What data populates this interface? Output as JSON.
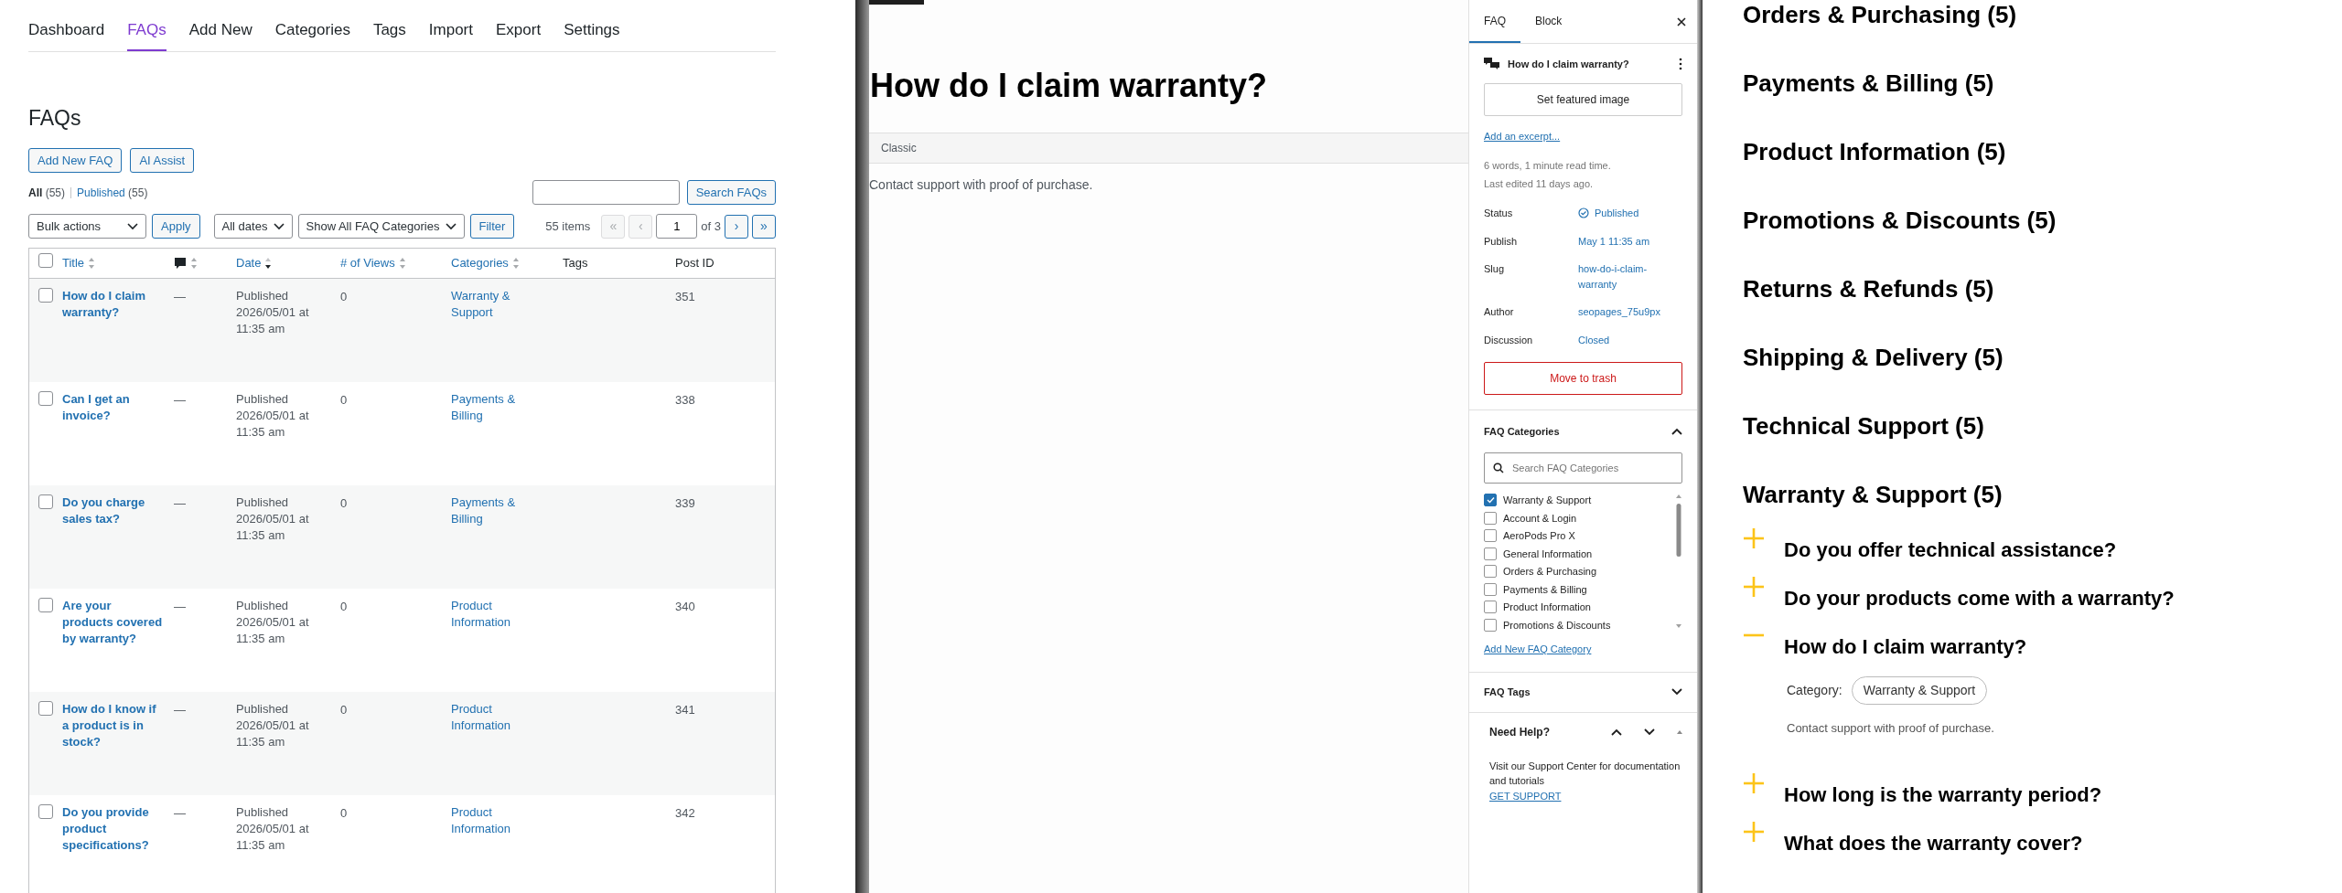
{
  "admin": {
    "nav": [
      {
        "label": "Dashboard",
        "selected": false
      },
      {
        "label": "FAQs",
        "selected": true
      },
      {
        "label": "Add New",
        "selected": false
      },
      {
        "label": "Categories",
        "selected": false
      },
      {
        "label": "Tags",
        "selected": false
      },
      {
        "label": "Import",
        "selected": false
      },
      {
        "label": "Export",
        "selected": false
      },
      {
        "label": "Settings",
        "selected": false
      }
    ],
    "page_title": "FAQs",
    "actions": [
      "Add New FAQ",
      "AI Assist"
    ],
    "views": [
      {
        "label": "All",
        "count": "(55)",
        "selected": true
      },
      {
        "label": "Published",
        "count": "(55)",
        "selected": false
      }
    ],
    "search_button": "Search FAQs",
    "bulk_actions": "Bulk actions",
    "apply": "Apply",
    "dates": "All dates",
    "category_filter": "Show All FAQ Categories",
    "filter": "Filter",
    "items_count": "55 items",
    "pagination": {
      "first": {
        "label": "«",
        "disabled": true
      },
      "prev": {
        "label": "‹",
        "disabled": true
      },
      "page": "1",
      "of": "of 3",
      "next": {
        "label": "›",
        "disabled": false
      },
      "last": {
        "label": "»",
        "disabled": false
      }
    },
    "table": {
      "select_all_checked": false,
      "columns": [
        {
          "kind": "text",
          "label": "Title",
          "sortable": true,
          "sorted": false
        },
        {
          "kind": "icon",
          "sortable": true,
          "sorted": false
        },
        {
          "kind": "text",
          "label": "Date",
          "sortable": true,
          "sorted": true
        },
        {
          "kind": "text",
          "label": "# of Views",
          "sortable": true,
          "sorted": false
        },
        {
          "kind": "text",
          "label": "Categories",
          "sortable": true,
          "sorted": false
        },
        {
          "kind": "text",
          "label": "Tags",
          "sortable": false
        },
        {
          "kind": "text",
          "label": "Post ID",
          "sortable": false
        }
      ],
      "rows": [
        {
          "checked": false,
          "title": "How do I claim warranty?",
          "comments": "—",
          "status": "Published",
          "date": "2026/05/01 at 11:35 am",
          "views": "0",
          "categories": "Warranty & Support",
          "post_id": "351"
        },
        {
          "checked": false,
          "title": "Can I get an invoice?",
          "comments": "—",
          "status": "Published",
          "date": "2026/05/01 at 11:35 am",
          "views": "0",
          "categories": "Payments & Billing",
          "post_id": "338"
        },
        {
          "checked": false,
          "title": "Do you charge sales tax?",
          "comments": "—",
          "status": "Published",
          "date": "2026/05/01 at 11:35 am",
          "views": "0",
          "categories": "Payments & Billing",
          "post_id": "339"
        },
        {
          "checked": false,
          "title": "Are your products covered by warranty?",
          "comments": "—",
          "status": "Published",
          "date": "2026/05/01 at 11:35 am",
          "views": "0",
          "categories": "Product Information",
          "post_id": "340"
        },
        {
          "checked": false,
          "title": "How do I know if a product is in stock?",
          "comments": "—",
          "status": "Published",
          "date": "2026/05/01 at 11:35 am",
          "views": "0",
          "categories": "Product Information",
          "post_id": "341"
        },
        {
          "checked": false,
          "title": "Do you provide product specifications?",
          "comments": "—",
          "status": "Published",
          "date": "2026/05/01 at 11:35 am",
          "views": "0",
          "categories": "Product Information",
          "post_id": "342"
        }
      ]
    }
  },
  "editor": {
    "title": "How do I claim warranty?",
    "block_label": "Classic",
    "content": "Contact support with proof of purchase."
  },
  "sidebar": {
    "tabs": [
      {
        "label": "FAQ",
        "selected": true
      },
      {
        "label": "Block",
        "selected": false
      }
    ],
    "post_title": "How do I claim warranty?",
    "featured_image_button": "Set featured image",
    "excerpt_link": "Add an excerpt...",
    "stats": [
      "6 words, 1 minute read time.",
      "Last edited 11 days ago."
    ],
    "meta": [
      {
        "label": "Status",
        "value": "Published",
        "kind": "status"
      },
      {
        "label": "Publish",
        "value": "May 1 11:35 am",
        "kind": "link"
      },
      {
        "label": "Slug",
        "value": "how-do-i-claim-warranty",
        "kind": "link"
      },
      {
        "label": "Author",
        "value": "seopages_75u9px",
        "kind": "link"
      },
      {
        "label": "Discussion",
        "value": "Closed",
        "kind": "link"
      }
    ],
    "trash_button": "Move to trash",
    "categories_panel": {
      "title": "FAQ Categories",
      "expanded": true,
      "search_placeholder": "Search FAQ Categories",
      "items": [
        {
          "label": "Warranty & Support",
          "checked": true
        },
        {
          "label": "Account & Login",
          "checked": false
        },
        {
          "label": "AeroPods Pro X",
          "checked": false
        },
        {
          "label": "General Information",
          "checked": false
        },
        {
          "label": "Orders & Purchasing",
          "checked": false
        },
        {
          "label": "Payments & Billing",
          "checked": false
        },
        {
          "label": "Product Information",
          "checked": false
        },
        {
          "label": "Promotions & Discounts",
          "checked": false
        }
      ],
      "add_link": "Add New FAQ Category"
    },
    "tags_panel": {
      "title": "FAQ Tags",
      "expanded": false
    },
    "help_panel": {
      "title": "Need Help?",
      "text": "Visit our Support Center for documentation and tutorials",
      "link": "GET SUPPORT"
    }
  },
  "preview": {
    "categories": [
      {
        "title": "Orders & Purchasing (5)"
      },
      {
        "title": "Payments & Billing (5)"
      },
      {
        "title": "Product Information (5)"
      },
      {
        "title": "Promotions & Discounts (5)"
      },
      {
        "title": "Returns & Refunds (5)"
      },
      {
        "title": "Shipping & Delivery (5)"
      },
      {
        "title": "Technical Support (5)"
      },
      {
        "title": "Warranty & Support (5)",
        "faqs": [
          {
            "question": "Do you offer technical assistance?",
            "expanded": false
          },
          {
            "question": "Do your products come with a warranty?",
            "expanded": false
          },
          {
            "question": "How do I claim warranty?",
            "expanded": true,
            "category_label": "Category:",
            "category": "Warranty & Support",
            "answer": "Contact support with proof of purchase."
          },
          {
            "question": "How long is the warranty period?",
            "expanded": false
          },
          {
            "question": "What does the warranty cover?",
            "expanded": false
          }
        ]
      }
    ]
  }
}
